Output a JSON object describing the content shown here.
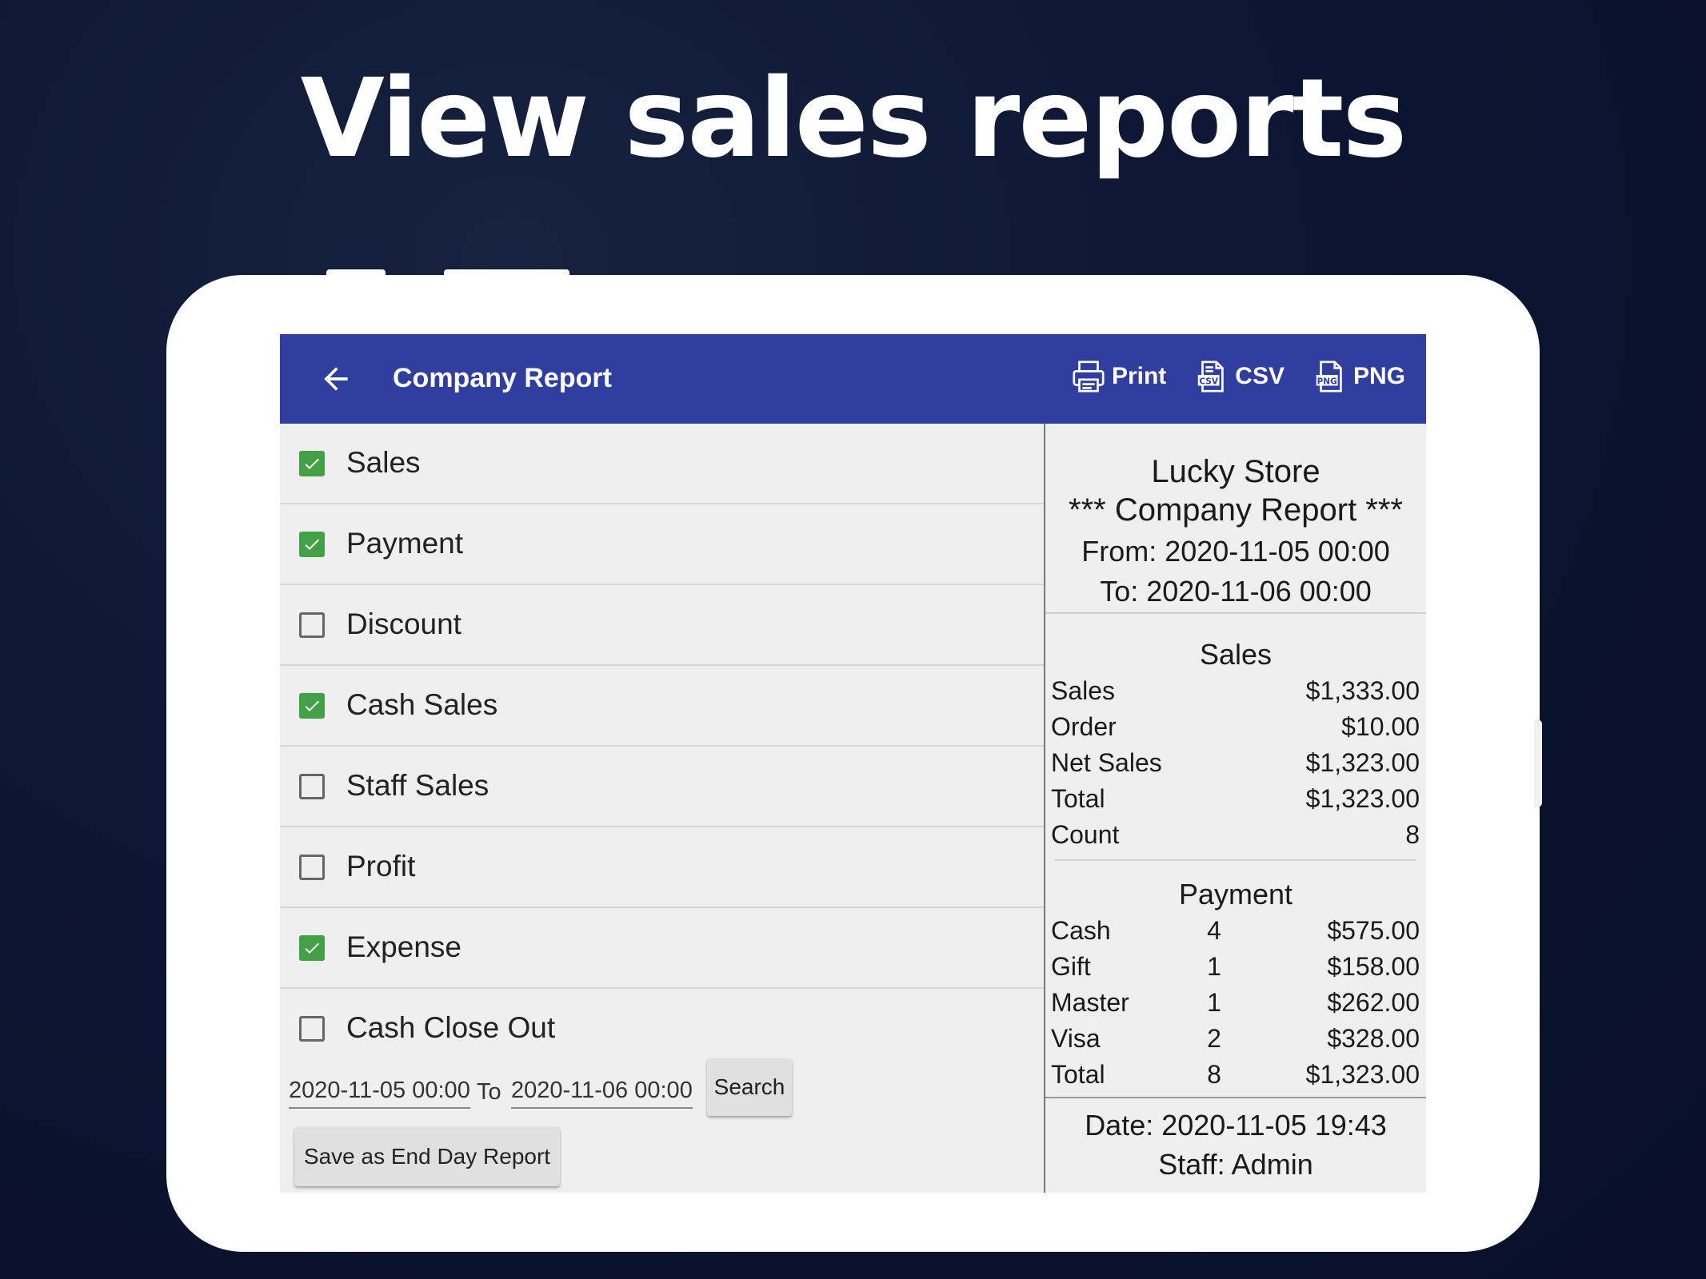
{
  "headline": "View sales reports",
  "app": {
    "title": "Company Report",
    "actions": [
      {
        "label": "Print",
        "icon": "printer-icon"
      },
      {
        "label": "CSV",
        "icon": "csv-file-icon"
      },
      {
        "label": "PNG",
        "icon": "png-file-icon"
      }
    ],
    "colors": {
      "appbar": "#303f9f",
      "checked": "#43a047"
    }
  },
  "options": [
    {
      "label": "Sales",
      "checked": true
    },
    {
      "label": "Payment",
      "checked": true
    },
    {
      "label": "Discount",
      "checked": false
    },
    {
      "label": "Cash Sales",
      "checked": true
    },
    {
      "label": "Staff Sales",
      "checked": false
    },
    {
      "label": "Profit",
      "checked": false
    },
    {
      "label": "Expense",
      "checked": true
    },
    {
      "label": "Cash Close Out",
      "checked": false
    }
  ],
  "range": {
    "from": "2020-11-05 00:00",
    "to_label": "To",
    "to": "2020-11-06 00:00",
    "search_label": "Search",
    "save_label": "Save as End Day Report"
  },
  "report": {
    "store": "Lucky Store",
    "title": "*** Company Report ***",
    "from_line": "From:  2020-11-05 00:00",
    "to_line": "To:  2020-11-06 00:00",
    "sales": {
      "heading": "Sales",
      "rows": [
        {
          "label": "Sales",
          "value": "$1,333.00"
        },
        {
          "label": "Order",
          "value": "$10.00"
        },
        {
          "label": "Net Sales",
          "value": "$1,323.00"
        },
        {
          "label": "Total",
          "value": "$1,323.00"
        },
        {
          "label": "Count",
          "value": "8"
        }
      ]
    },
    "payment": {
      "heading": "Payment",
      "rows": [
        {
          "label": "Cash",
          "count": "4",
          "value": "$575.00"
        },
        {
          "label": "Gift",
          "count": "1",
          "value": "$158.00"
        },
        {
          "label": "Master",
          "count": "1",
          "value": "$262.00"
        },
        {
          "label": "Visa",
          "count": "2",
          "value": "$328.00"
        },
        {
          "label": "Total",
          "count": "8",
          "value": "$1,323.00"
        }
      ]
    },
    "date_line": "Date:  2020-11-05 19:43",
    "staff_line": "Staff:  Admin"
  }
}
